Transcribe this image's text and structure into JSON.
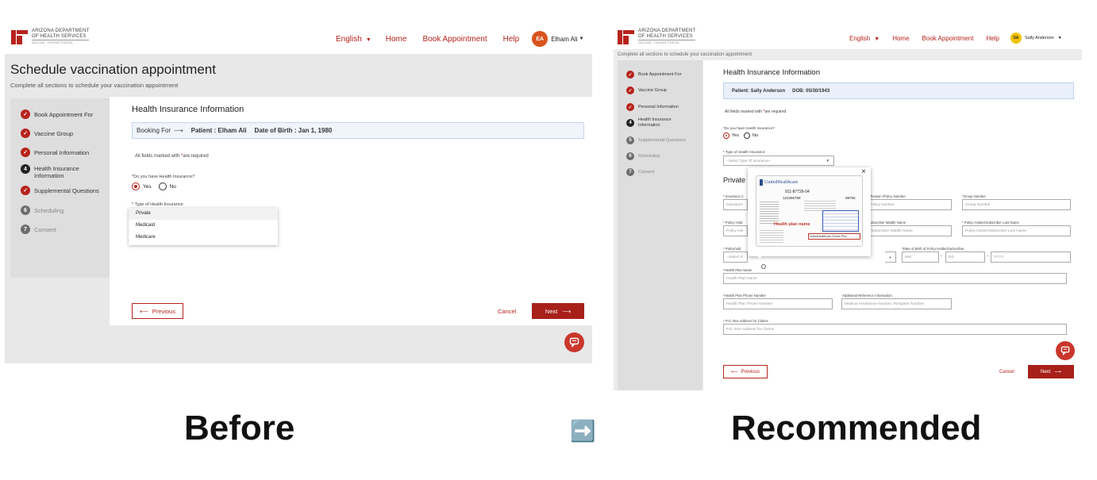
{
  "before": {
    "logo": {
      "line1": "ARIZONA DEPARTMENT",
      "line2": "OF HEALTH SERVICES",
      "line3": "VACCINE · PATIENT PORTAL"
    },
    "nav": {
      "language": "English",
      "home": "Home",
      "book": "Book Appointment",
      "help": "Help"
    },
    "user": {
      "initials": "EA",
      "name": "Elham Ali"
    },
    "page_title": "Schedule vaccination appointment",
    "page_subtitle": "Complete all sections to schedule your vaccination appointment",
    "steps": [
      {
        "label": "Book Appointment For",
        "state": "done",
        "num": ""
      },
      {
        "label": "Vaccine Group",
        "state": "done",
        "num": ""
      },
      {
        "label": "Personal Information",
        "state": "done",
        "num": ""
      },
      {
        "label": "Health Insurance Information",
        "state": "current",
        "num": "4"
      },
      {
        "label": "Supplemental Questions",
        "state": "done",
        "num": ""
      },
      {
        "label": "Scheduling",
        "state": "todo",
        "num": "6"
      },
      {
        "label": "Consent",
        "state": "todo",
        "num": "7"
      }
    ],
    "section_title": "Health Insurance Information",
    "booking_bar": {
      "prefix": "Booking For",
      "patient": "Patient : Elham Ali",
      "dob": "Date of Birth : Jan 1, 1980"
    },
    "required_note": "All fields marked with",
    "required_note_tail": "are required",
    "question": "*Do you have Health Insurance?",
    "yes": "Yes",
    "no": "No",
    "type_label": "* Type of Health Insurance",
    "dropdown_options": [
      "Private",
      "Medicaid",
      "Medicare"
    ],
    "prev_btn": "Previous",
    "cancel_btn": "Cancel",
    "next_btn": "Next"
  },
  "after": {
    "logo": {
      "line1": "ARIZONA DEPARTMENT",
      "line2": "OF HEALTH SERVICES",
      "line3": "VACCINE · PATIENT PORTAL"
    },
    "nav": {
      "language": "English",
      "home": "Home",
      "book": "Book Appointment",
      "help": "Help"
    },
    "user": {
      "initials": "SA",
      "name": "Sally Anderson"
    },
    "page_subtitle": "Complete all sections to schedule your vaccination appointment",
    "steps": [
      {
        "label": "Book Appointment For",
        "state": "done",
        "num": ""
      },
      {
        "label": "Vaccine Group",
        "state": "done",
        "num": ""
      },
      {
        "label": "Personal Information",
        "state": "done",
        "num": ""
      },
      {
        "label": "Health Insurance Information",
        "state": "current",
        "num": "4"
      },
      {
        "label": "Supplemental Questions",
        "state": "todo",
        "num": "5"
      },
      {
        "label": "Scheduling",
        "state": "todo",
        "num": "6"
      },
      {
        "label": "Consent",
        "state": "todo",
        "num": "7"
      }
    ],
    "section_title": "Health Insurance Information",
    "patient_bar": {
      "patient": "Patient: Sally Anderson",
      "dob": "DOB: 05/30/1943"
    },
    "required_note": "All fields marked with",
    "required_note_tail": "are required",
    "question": "*Do you have Health Insurance?",
    "yes": "Yes",
    "no": "No",
    "type_label": "* Type of Health Insurance",
    "type_placeholder": "--Select Type Of Insurance--",
    "private_title": "Private Insurance Information",
    "fields": {
      "insurance_label": "* Insurance C",
      "insurance_ph": "Insurance",
      "policy_num_label": "fication /Policy Number",
      "policy_num_ph": "Policy Number",
      "group_label": "*Group Number",
      "group_ph": "Group Number",
      "holder_label": "* Policy Hold",
      "holder_ph": "Policy Hol",
      "middle_label": "ubscriber Middle Name",
      "middle_ph": "/Subscriber Middle Name",
      "last_label": "* Policy Holder/Subscriber Last Name",
      "last_ph": "Policy Holder/Subscriber Last Name",
      "rel_label": "* Policyhold",
      "rel_ph": "--Select R",
      "dob_label": "*Date of Birth of Policy Holder/Subscriber",
      "mm": "MM",
      "dd": "DD",
      "yyyy": "YYYY",
      "plan_name_label": "*Health Plan Name",
      "plan_name_ph": "Health Plan Name",
      "plan_phone_label": "*Health Plan Phone Number",
      "plan_phone_ph": "Health Plan Phone Number",
      "add_ref_label": "Additional Reference Information",
      "add_ref_ph": "Medical Assistance Number, Recipient Number",
      "po_label": "* P.O. Box Address for Claims",
      "po_ph": "P.O. Box Address for Claims"
    },
    "card": {
      "brand": "UnitedHealthcare",
      "payer": "911-87726-04",
      "member_id": "123456789",
      "group": "98765",
      "annotation": "Health plan name",
      "highlight": "UnitedHealthcare Choice Plus",
      "close": "×"
    },
    "prev_btn": "Previous",
    "cancel_btn": "Cancel",
    "next_btn": "Next"
  },
  "labels": {
    "before": "Before",
    "arrow": "➡️",
    "recommended": "Recommended"
  },
  "colors": {
    "brand_red": "#b7231c",
    "panel_gray": "#e8e8e8",
    "avatar_before": "#d9531e",
    "avatar_after": "#f3c200"
  }
}
